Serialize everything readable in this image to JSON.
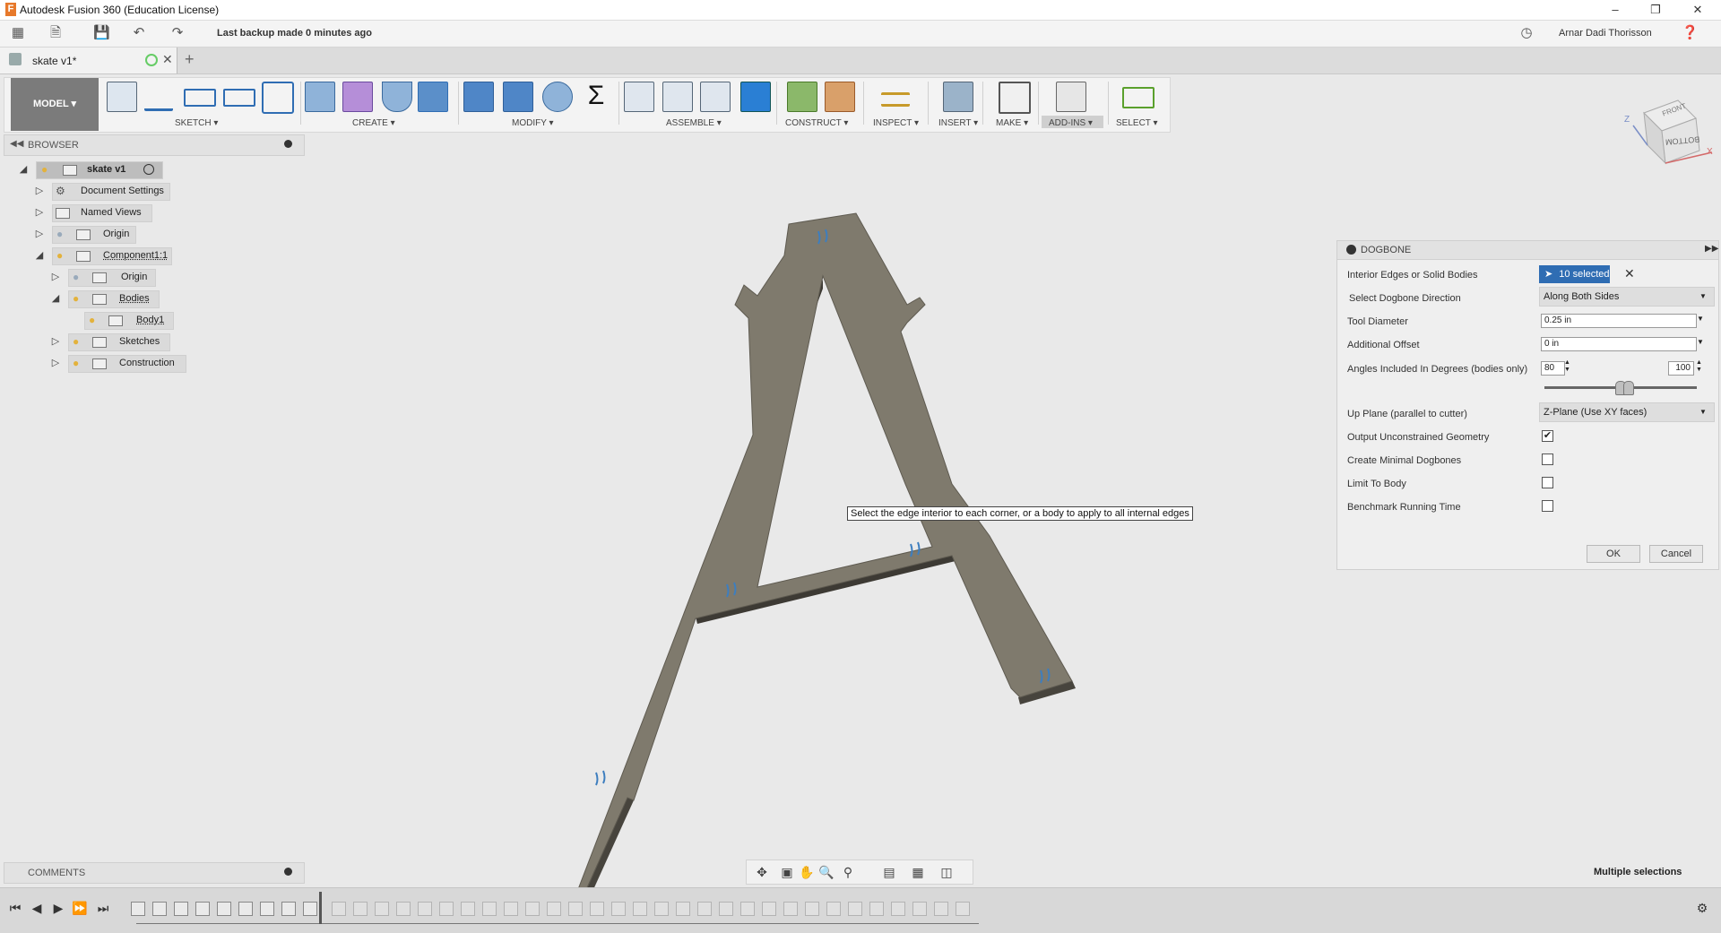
{
  "window": {
    "title": "Autodesk Fusion 360 (Education License)",
    "controls": [
      "minimize-icon",
      "restore-icon",
      "close-icon"
    ]
  },
  "quick_toolbar": {
    "backup_status": "Last backup made 0 minutes ago",
    "user_name": "Arnar Dadi Thorisson",
    "icons": [
      "apps-grid-icon",
      "file-icon",
      "save-icon",
      "undo-icon",
      "redo-icon",
      "clock-icon",
      "help-icon"
    ]
  },
  "tabs": {
    "document": "skate v1*",
    "new_tab": "+"
  },
  "ribbon": {
    "workspace": "MODEL ▾",
    "groups": [
      {
        "label": "SKETCH ▾"
      },
      {
        "label": "CREATE ▾"
      },
      {
        "label": "MODIFY ▾"
      },
      {
        "label": "ASSEMBLE ▾"
      },
      {
        "label": "CONSTRUCT ▾"
      },
      {
        "label": "INSPECT ▾"
      },
      {
        "label": "INSERT ▾"
      },
      {
        "label": "MAKE ▾"
      },
      {
        "label": "ADD-INS ▾"
      },
      {
        "label": "SELECT ▾"
      }
    ]
  },
  "browser": {
    "title": "BROWSER",
    "items": [
      {
        "label": "skate v1",
        "expander": "◢"
      },
      {
        "label": "Document Settings",
        "expander": "▷"
      },
      {
        "label": "Named Views",
        "expander": "▷"
      },
      {
        "label": "Origin",
        "expander": "▷"
      },
      {
        "label": "Component1:1",
        "expander": "◢"
      },
      {
        "label": "Origin",
        "expander": "▷"
      },
      {
        "label": "Bodies",
        "expander": "◢"
      },
      {
        "label": "Body1",
        "expander": ""
      },
      {
        "label": "Sketches",
        "expander": "▷"
      },
      {
        "label": "Construction",
        "expander": "▷"
      }
    ]
  },
  "viewcube": {
    "front": "FRONT",
    "bottom": "BOTTOM",
    "axis_z": "Z",
    "axis_x": "X"
  },
  "dialog": {
    "title": "DOGBONE",
    "interior_edges_label": "Interior Edges or Solid Bodies",
    "selection_chip": "10 selected",
    "direction_label": "Select Dogbone Direction",
    "direction_value": "Along Both Sides",
    "tool_diameter_label": "Tool Diameter",
    "tool_diameter_value": "0.25 in",
    "offset_label": "Additional Offset",
    "offset_value": "0 in",
    "angles_label": "Angles Included In Degrees (bodies only)",
    "angle_min": "80",
    "angle_max": "100",
    "angle_range_fraction": [
      0.5,
      0.55
    ],
    "up_plane_label": "Up Plane (parallel to cutter)",
    "up_plane_value": "Z-Plane (Use XY faces)",
    "checkboxes": [
      {
        "label": "Output Unconstrained Geometry",
        "checked": true
      },
      {
        "label": "Create Minimal Dogbones",
        "checked": false
      },
      {
        "label": "Limit To Body",
        "checked": false
      },
      {
        "label": "Benchmark Running Time",
        "checked": false
      }
    ],
    "ok": "OK",
    "cancel": "Cancel"
  },
  "tooltip": "Select the edge interior to each corner, or a body to apply to all internal edges",
  "comments": {
    "title": "COMMENTS"
  },
  "status": {
    "selection": "Multiple selections"
  },
  "colors": {
    "body": "#7f7a6d",
    "body_side": "#47443d",
    "selection": "#3d7ebf",
    "active_tool": "#5b8fc9"
  }
}
